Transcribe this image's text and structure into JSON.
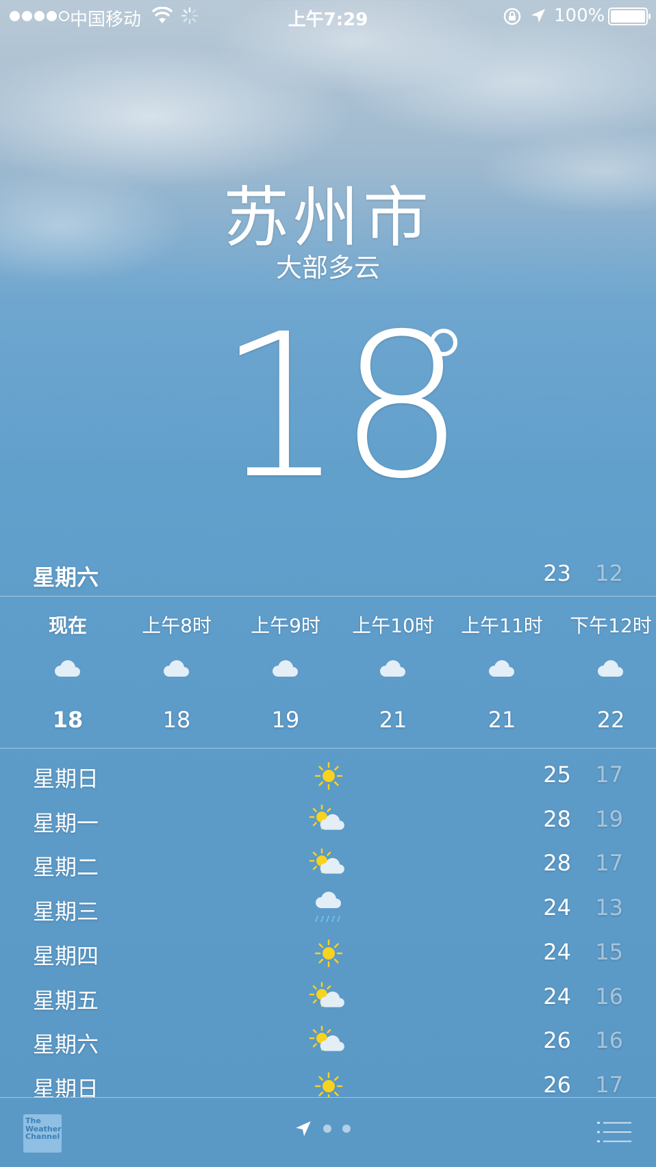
{
  "status_bar": {
    "signal_dots": 5,
    "signal_filled": 4,
    "carrier": "中国移动",
    "time": "上午7:29",
    "battery": "100%"
  },
  "location": {
    "city": "苏州市",
    "condition": "大部多云",
    "temperature": "18"
  },
  "today": {
    "day": "星期六",
    "high": "23",
    "low": "12"
  },
  "hourly": [
    {
      "label": "现在",
      "icon": "cloud-icon",
      "temp": "18"
    },
    {
      "label": "上午8时",
      "icon": "cloud-icon",
      "temp": "18"
    },
    {
      "label": "上午9时",
      "icon": "cloud-icon",
      "temp": "19"
    },
    {
      "label": "上午10时",
      "icon": "cloud-icon",
      "temp": "21"
    },
    {
      "label": "上午11时",
      "icon": "cloud-icon",
      "temp": "21"
    },
    {
      "label": "下午12时",
      "icon": "cloud-icon",
      "temp": "22"
    }
  ],
  "daily": [
    {
      "day": "星期日",
      "icon": "sun-icon",
      "high": "25",
      "low": "17"
    },
    {
      "day": "星期一",
      "icon": "partly-cloudy-icon",
      "high": "28",
      "low": "19"
    },
    {
      "day": "星期二",
      "icon": "partly-cloudy-icon",
      "high": "28",
      "low": "17"
    },
    {
      "day": "星期三",
      "icon": "rain-icon",
      "high": "24",
      "low": "13"
    },
    {
      "day": "星期四",
      "icon": "sun-icon",
      "high": "24",
      "low": "15"
    },
    {
      "day": "星期五",
      "icon": "partly-cloudy-icon",
      "high": "24",
      "low": "16"
    },
    {
      "day": "星期六",
      "icon": "partly-cloudy-icon",
      "high": "26",
      "low": "16"
    },
    {
      "day": "星期日",
      "icon": "sun-icon",
      "high": "26",
      "low": "17"
    }
  ],
  "footer": {
    "logo_lines": [
      "The",
      "Weather",
      "Channel"
    ],
    "page_count": 2,
    "current_page": "location"
  },
  "colors": {
    "sun": "#f7d21e",
    "cloud": "#e3eef6",
    "rain": "#6cc2f2"
  }
}
